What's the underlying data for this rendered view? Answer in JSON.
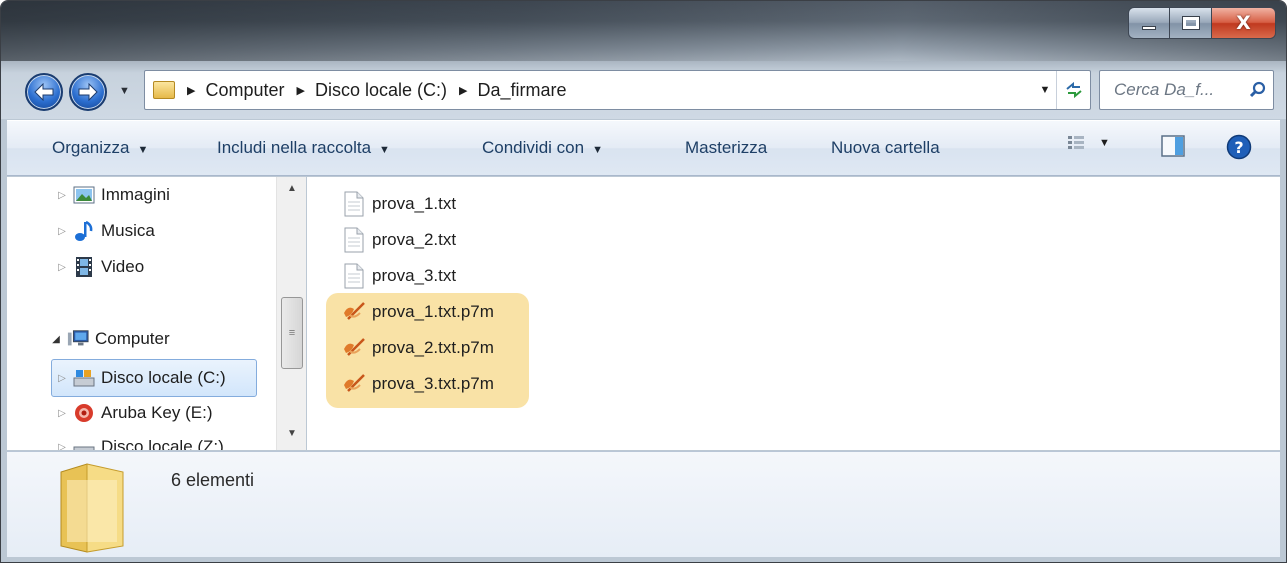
{
  "window": {
    "minimize_glyph": "",
    "maximize_glyph": "",
    "close_glyph": "X"
  },
  "nav": {
    "back_icon": "back-arrow-icon",
    "forward_icon": "forward-arrow-icon"
  },
  "address": {
    "crumbs": [
      "Computer",
      "Disco locale (C:)",
      "Da_firmare"
    ]
  },
  "search": {
    "placeholder": "Cerca Da_f..."
  },
  "commandbar": {
    "organizza": "Organizza",
    "includi": "Includi nella raccolta",
    "condividi": "Condividi con",
    "masterizza": "Masterizza",
    "nuova_cartella": "Nuova cartella"
  },
  "navpane": {
    "items": [
      {
        "label": "Immagini",
        "icon": "pictures-library-icon"
      },
      {
        "label": "Musica",
        "icon": "music-library-icon"
      },
      {
        "label": "Video",
        "icon": "video-library-icon"
      },
      {
        "label": "Computer",
        "icon": "computer-icon"
      },
      {
        "label": "Disco locale (C:)",
        "icon": "local-disk-icon",
        "selected": true
      },
      {
        "label": "Aruba Key (E:)",
        "icon": "aruba-key-icon"
      },
      {
        "label": "Disco locale (Z:)",
        "icon": "local-disk-icon"
      }
    ]
  },
  "files": [
    {
      "name": "prova_1.txt",
      "icon": "text-file-icon"
    },
    {
      "name": "prova_2.txt",
      "icon": "text-file-icon"
    },
    {
      "name": "prova_3.txt",
      "icon": "text-file-icon"
    },
    {
      "name": "prova_1.txt.p7m",
      "icon": "signed-file-icon"
    },
    {
      "name": "prova_2.txt.p7m",
      "icon": "signed-file-icon"
    },
    {
      "name": "prova_3.txt.p7m",
      "icon": "signed-file-icon"
    }
  ],
  "details": {
    "count": "6 elementi"
  },
  "colors": {
    "highlight": "#f9e2a6",
    "selection_border": "#84acdd",
    "command_text": "#1e3f66"
  }
}
